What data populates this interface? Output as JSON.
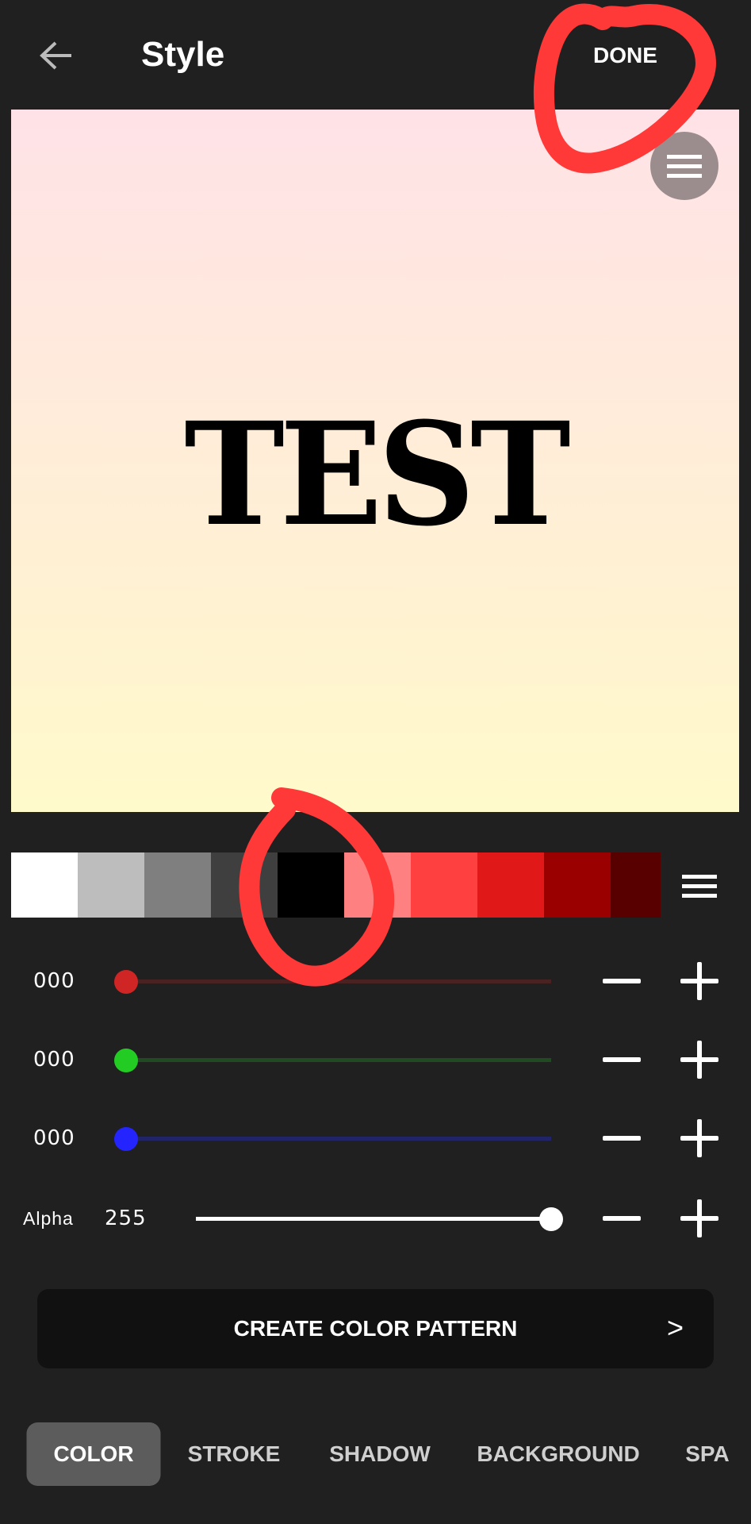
{
  "header": {
    "title": "Style",
    "done_label": "DONE",
    "back_icon": "arrow-left-icon",
    "more_icon": "more-vertical-icon"
  },
  "preview": {
    "text": "TEST",
    "text_color": "#000000",
    "gradient": [
      "#ffe2e7",
      "#fffacb"
    ],
    "menu_icon": "hamburger-icon"
  },
  "palette": {
    "swatches": [
      "#ffffff",
      "#bdbdbd",
      "#7f7f7f",
      "#3f3f3f",
      "#000000",
      "#ff8080",
      "#ff4040",
      "#e01818",
      "#9a0000",
      "#580000"
    ],
    "selected": "#000000",
    "menu_icon": "hamburger-icon"
  },
  "sliders": {
    "red": {
      "value": "000",
      "level": 0,
      "color": "#d02525",
      "track": "#4a2222"
    },
    "green": {
      "value": "000",
      "level": 0,
      "color": "#22cc22",
      "track": "#1f4a22"
    },
    "blue": {
      "value": "000",
      "level": 0,
      "color": "#2424ff",
      "track": "#22246a"
    },
    "alpha": {
      "label": "Alpha",
      "value": "255",
      "level": 1,
      "color": "#ffffff",
      "track": "#ffffff"
    }
  },
  "pattern_button": {
    "label": "CREATE COLOR PATTERN",
    "chevron": ">"
  },
  "tabs": [
    {
      "label": "COLOR",
      "active": true
    },
    {
      "label": "STROKE"
    },
    {
      "label": "SHADOW"
    },
    {
      "label": "BACKGROUND"
    },
    {
      "label": "SPA"
    }
  ],
  "annotation_color": "#ff3838"
}
